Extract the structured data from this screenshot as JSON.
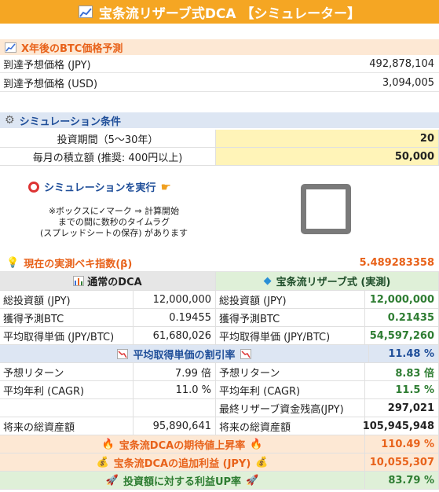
{
  "title": "宝条流リザーブ式DCA 【シミュレーター】",
  "btc": {
    "heading": "X年後のBTC価格予測",
    "rows": [
      {
        "label": "到達予想価格 (JPY)",
        "value": "492,878,104"
      },
      {
        "label": "到達予想価格 (USD)",
        "value": "3,094,005"
      }
    ]
  },
  "cond": {
    "heading": "シミュレーション条件",
    "rows": [
      {
        "label": "投資期間（5〜30年）",
        "value": "20"
      },
      {
        "label": "毎月の積立額 (推奨: 400円以上)",
        "value": "50,000"
      }
    ]
  },
  "run": {
    "label": "シミュレーションを実行",
    "note1": "※ボックスに✓マーク ⇒ 計算開始",
    "note2": "までの間に数秒のタイムラグ",
    "note3": "(スプレッドシートの保存) があります"
  },
  "beta": {
    "label": "現在の実測ベキ指数(β)",
    "value": "5.489283358"
  },
  "dca_head": "通常のDCA",
  "res_head": "宝条流リザーブ式 (実測)",
  "table1": [
    {
      "l1": "総投資額 (JPY)",
      "v1": "12,000,000",
      "l2": "総投資額 (JPY)",
      "v2": "12,000,000"
    },
    {
      "l1": "獲得予測BTC",
      "v1": "0.19455",
      "l2": "獲得予測BTC",
      "v2": "0.21435"
    },
    {
      "l1": "平均取得単価 (JPY/BTC)",
      "v1": "61,680,026",
      "l2": "平均取得単価 (JPY/BTC)",
      "v2": "54,597,260"
    }
  ],
  "discount": {
    "label": "平均取得単価の割引率",
    "value": "11.48 %"
  },
  "table2": [
    {
      "l1": "予想リターン",
      "v1": "7.99 倍",
      "l2": "予想リターン",
      "v2": "8.83 倍"
    },
    {
      "l1": "平均年利 (CAGR)",
      "v1": "11.0 %",
      "l2": "平均年利 (CAGR)",
      "v2": "11.5 %"
    },
    {
      "l1": "",
      "v1": "",
      "l2": "最終リザーブ資金残高(JPY)",
      "v2": "297,021"
    },
    {
      "l1": "将来の総資産額",
      "v1": "95,890,641",
      "l2": "将来の総資産額",
      "v2": "105,945,948"
    }
  ],
  "summary": [
    {
      "label": "宝条流DCAの期待値上昇率",
      "value": "110.49 %"
    },
    {
      "label": "宝条流DCAの追加利益 (JPY)",
      "value": "10,055,307"
    },
    {
      "label": "投資額に対する利益UP率",
      "value": "83.79 %"
    }
  ],
  "colors": {
    "banner": "#f5a623",
    "btc_head_bg": "#fde8d4",
    "cond_head_bg": "#dde6f3",
    "input_bg": "#fff4b8",
    "dca_head_bg": "#e6e6e6",
    "res_head_bg": "#dff0d8"
  }
}
